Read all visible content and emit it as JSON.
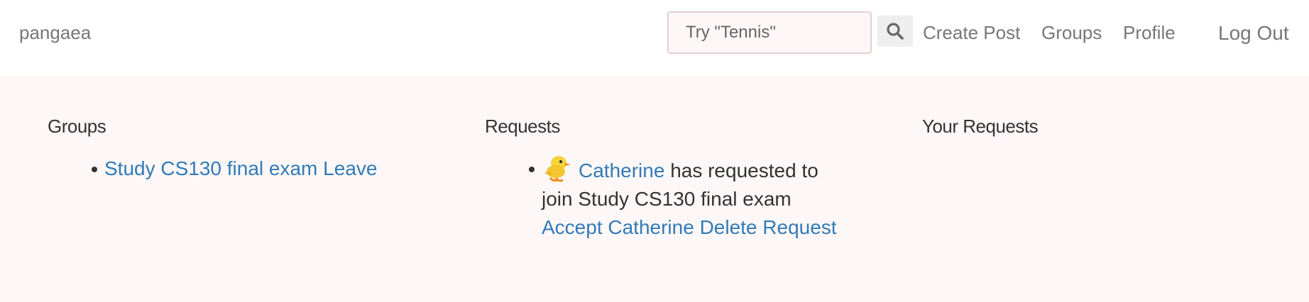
{
  "navbar": {
    "brand": "pangaea",
    "search": {
      "placeholder": "Try \"Tennis\"",
      "value": ""
    },
    "links": {
      "create_post": "Create Post",
      "groups": "Groups",
      "profile": "Profile",
      "logout": "Log Out"
    }
  },
  "groups": {
    "heading": "Groups",
    "items": [
      {
        "name": "Study CS130 final exam",
        "leave_label": "Leave"
      }
    ]
  },
  "requests": {
    "heading": "Requests",
    "items": [
      {
        "user": "Catherine",
        "message": "has requested to join Study CS130 final exam",
        "accept_label": "Accept Catherine",
        "delete_label": "Delete Request"
      }
    ]
  },
  "your_requests": {
    "heading": "Your Requests"
  },
  "colors": {
    "link": "#337ab7",
    "nav_text": "#777777",
    "page_bg": "#fdf8f7",
    "search_border": "#e3cfcf"
  },
  "icons": {
    "search_button": "search-icon",
    "request_avatar": "bird-avatar-icon"
  }
}
